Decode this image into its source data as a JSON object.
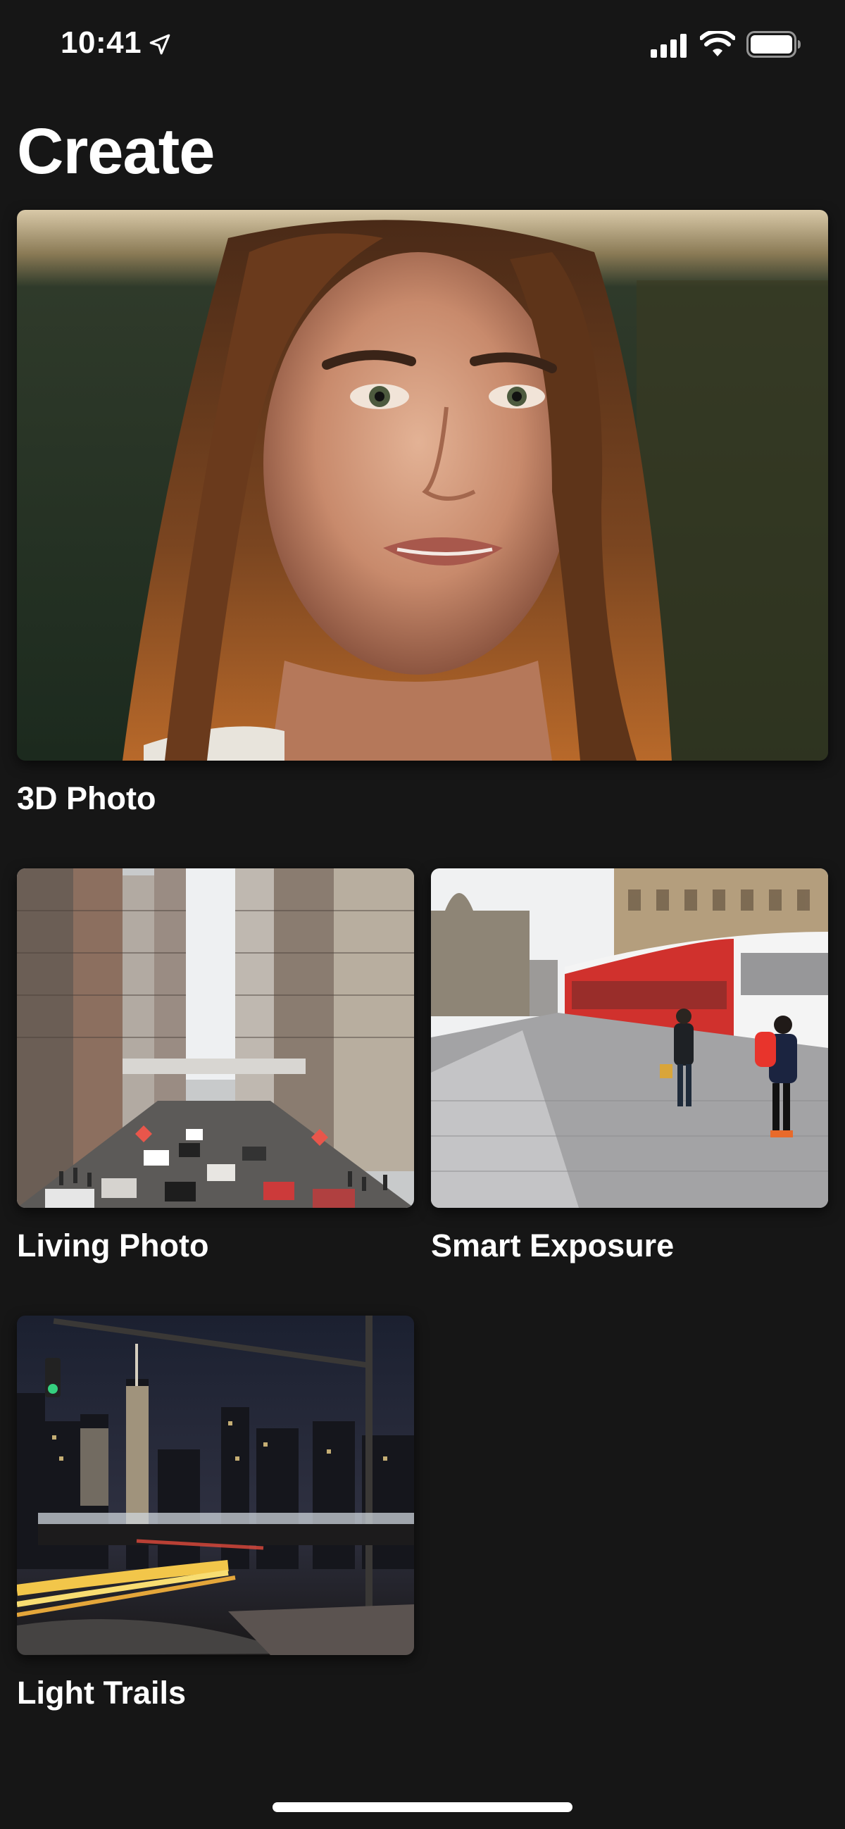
{
  "status_bar": {
    "time": "10:41",
    "icons": [
      "location-arrow-icon",
      "cellular-signal-icon",
      "wifi-icon",
      "battery-icon"
    ]
  },
  "page": {
    "title": "Create"
  },
  "cards": [
    {
      "id": "3d-photo",
      "label": "3D Photo",
      "thumbnail": "portrait-woman"
    },
    {
      "id": "living-photo",
      "label": "Living Photo",
      "thumbnail": "city-street-traffic"
    },
    {
      "id": "smart-exposure",
      "label": "Smart Exposure",
      "thumbnail": "tram-plaza"
    },
    {
      "id": "light-trails",
      "label": "Light Trails",
      "thumbnail": "night-city-light-trails"
    }
  ],
  "colors": {
    "background": "#161616",
    "text": "#ffffff"
  }
}
